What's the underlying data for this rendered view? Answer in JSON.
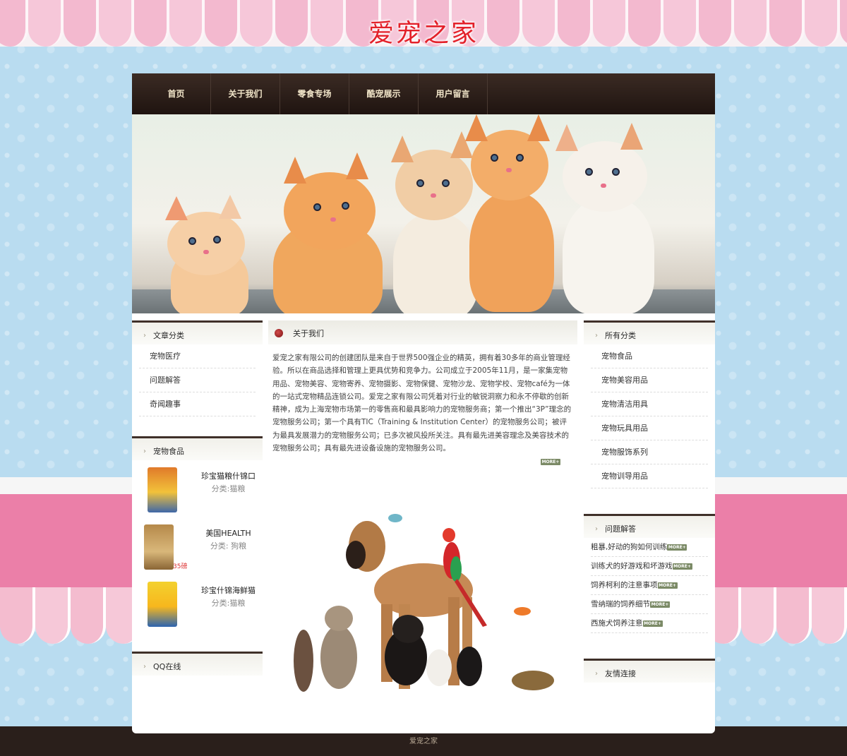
{
  "site": {
    "logo_text": "爱宠之家"
  },
  "nav": {
    "items": [
      "首页",
      "关于我们",
      "零食专场",
      "酷宠展示",
      "用户留言"
    ]
  },
  "left": {
    "article_heading": "文章分类",
    "articles": [
      "宠物医疗",
      "问题解答",
      "奇闻趣事"
    ],
    "food_heading": "宠物食品",
    "products": [
      {
        "name": "珍宝猫粮什锦口",
        "category": "分类:猫粮",
        "tag": ""
      },
      {
        "name": "美国HEALTH",
        "category": "分类: 狗粮",
        "tag": "35磅"
      },
      {
        "name": "珍宝什锦海鲜猫",
        "category": "分类:猫粮",
        "tag": ""
      }
    ],
    "qq_heading": "QQ在线"
  },
  "main": {
    "about_heading": "关于我们",
    "about_text": "爱宠之家有限公司的创建团队是来自于世界500强企业的精英，拥有着30多年的商业管理经验。所以在商品选择和管理上更具优势和竞争力。公司成立于2005年11月，是一家集宠物用品、宠物美容、宠物寄养、宠物摄影、宠物保健、宠物沙龙、宠物学校、宠物café为一体的一站式宠物精品连锁公司。爱宠之家有限公司凭着对行业的敏锐洞察力和永不停歇的创新精神，成为上海宠物市场第一的零售商和最具影响力的宠物服务商；第一个推出“3P”理念的宠物服务公司；第一个具有TIC（Training & Institution Center）的宠物服务公司；被评为最具发展潜力的宠物服务公司；已多次被风投所关注。具有最先进美容理念及美容技术的宠物服务公司；具有最先进设备设施的宠物服务公司。",
    "more_label": "MORE+"
  },
  "right": {
    "category_heading": "所有分类",
    "categories": [
      "宠物食品",
      "宠物美容用品",
      "宠物清洁用具",
      "宠物玩具用品",
      "宠物服饰系列",
      "宠物训导用品"
    ],
    "qa_heading": "问题解答",
    "qa_items": [
      "粗暴,好动的狗如何训练",
      "训练犬的好游戏和坏游戏",
      "饲养柯利的注意事项",
      "雪纳瑞的饲养细节",
      "西施犬饲养注意"
    ],
    "more_label": "MORE+",
    "links_heading": "友情连接"
  },
  "footer": {
    "text": "爱宠之家"
  },
  "colors": {
    "nav_bg": "#2b1e19",
    "accent_red": "#e3212a",
    "pink_band": "#eb7fa8",
    "sky": "#b9dcf0"
  }
}
